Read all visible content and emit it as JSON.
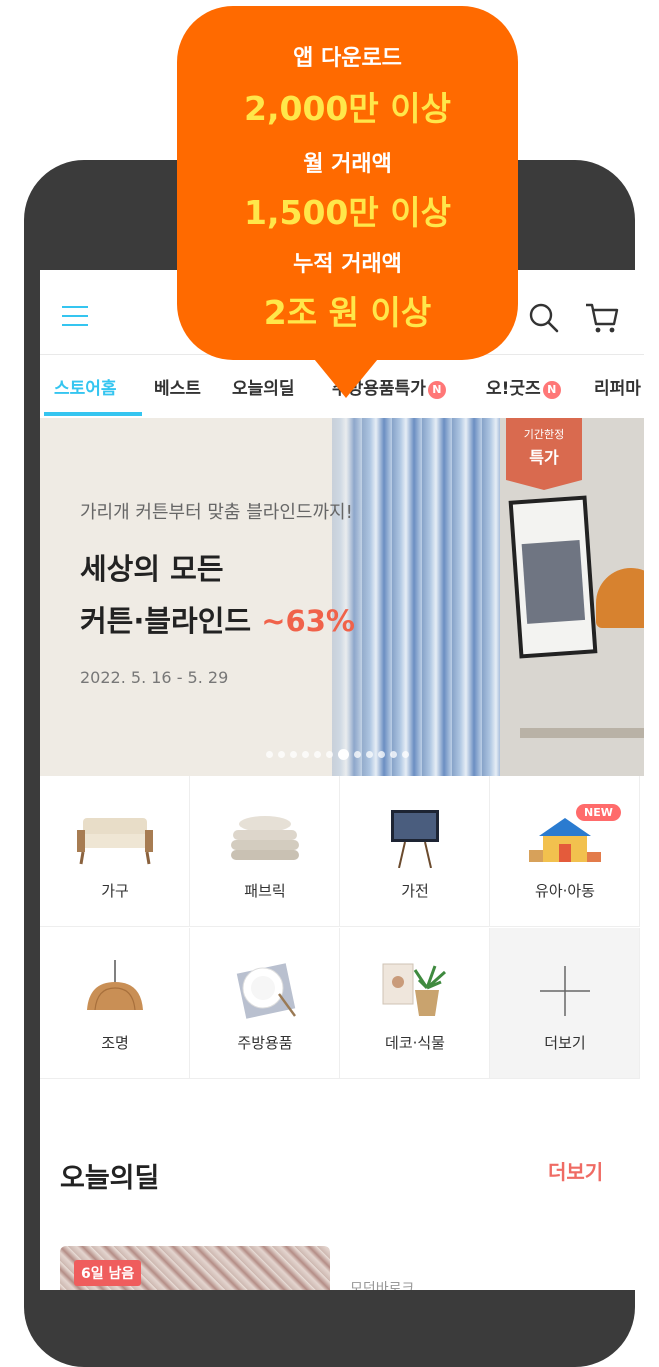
{
  "promo": {
    "line1": "앱 다운로드",
    "line2": "2,000만 이상",
    "line3": "월 거래액",
    "line4": "1,500만 이상",
    "line5": "누적 거래액",
    "line6": "2조 원 이상"
  },
  "header": {
    "menu_icon": "hamburger-menu-icon",
    "search_icon": "search-icon",
    "cart_icon": "cart-icon"
  },
  "nav": {
    "tabs": [
      {
        "label": "스토어홈"
      },
      {
        "label": "베스트"
      },
      {
        "label": "오늘의딜"
      },
      {
        "label": "주방용품특가",
        "badge": "N"
      },
      {
        "label": "오!굿즈",
        "badge": "N"
      },
      {
        "label": "리퍼마"
      }
    ]
  },
  "banner": {
    "subtitle": "가리개 커튼부터 맞춤 블라인드까지!",
    "title_line1": "세상의 모든",
    "title_line2": "커튼·블라인드",
    "discount": "~63%",
    "date": "2022. 5. 16 - 5. 29",
    "ribbon_small": "기간한정",
    "ribbon_big": "특가",
    "slide_count": 12,
    "active_slide": 7
  },
  "categories": [
    {
      "label": "가구",
      "icon": "sofa-icon"
    },
    {
      "label": "패브릭",
      "icon": "bedding-icon"
    },
    {
      "label": "가전",
      "icon": "tv-icon"
    },
    {
      "label": "유아·아동",
      "icon": "playhouse-icon",
      "tag": "NEW"
    },
    {
      "label": "조명",
      "icon": "pendant-lamp-icon"
    },
    {
      "label": "주방용품",
      "icon": "plate-icon"
    },
    {
      "label": "데코·식물",
      "icon": "plant-icon"
    },
    {
      "label": "더보기",
      "icon": "plus-icon"
    }
  ],
  "today_deal": {
    "title": "오늘의딜",
    "more_label": "더보기",
    "badge": "6일 남음",
    "brand": "모던바로크"
  },
  "colors": {
    "accent": "#35c5f0",
    "promo_bg": "#ff6a00",
    "promo_highlight": "#ffe74a",
    "sale_red": "#ef6b64"
  }
}
